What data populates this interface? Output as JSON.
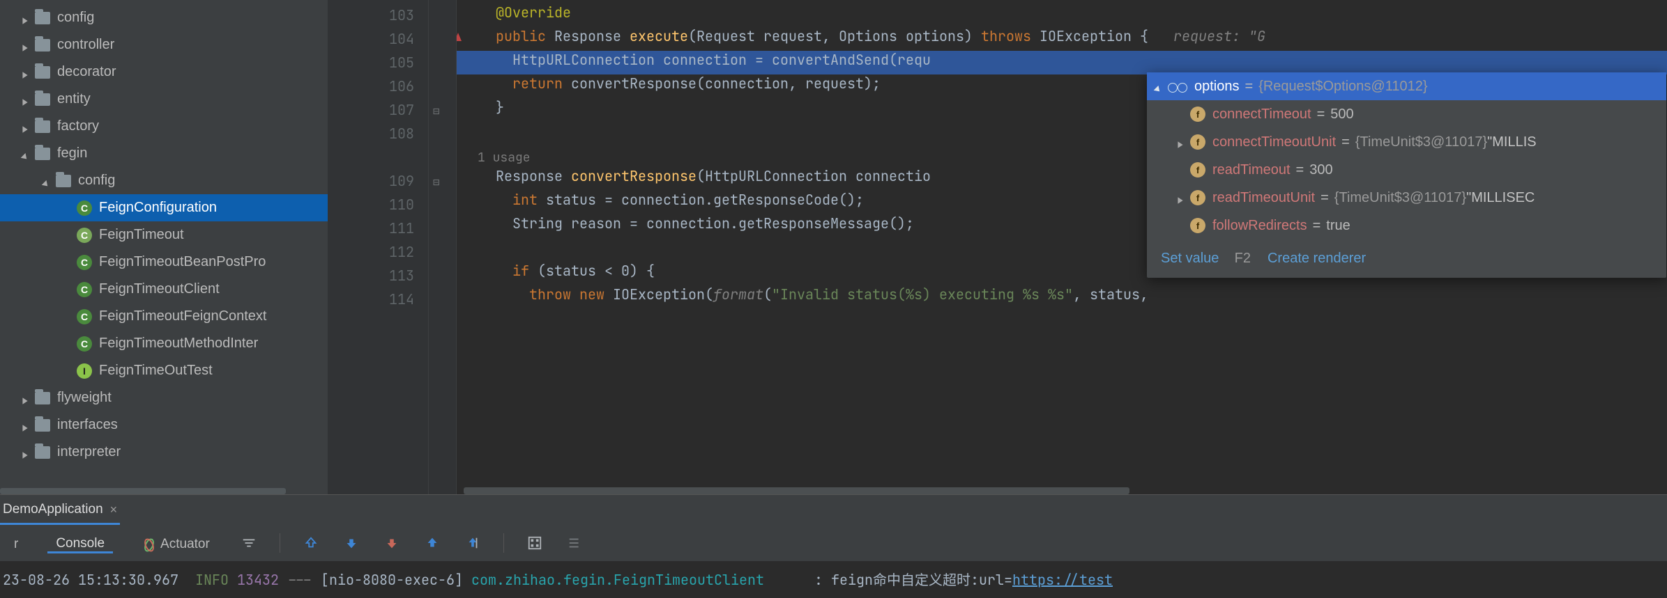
{
  "project_tree": {
    "items": [
      {
        "indent": 30,
        "arrow": "closed",
        "icon": "folder",
        "label": "config",
        "selected": false
      },
      {
        "indent": 30,
        "arrow": "closed",
        "icon": "folder",
        "label": "controller",
        "selected": false
      },
      {
        "indent": 30,
        "arrow": "closed",
        "icon": "folder",
        "label": "decorator",
        "selected": false
      },
      {
        "indent": 30,
        "arrow": "closed",
        "icon": "folder",
        "label": "entity",
        "selected": false
      },
      {
        "indent": 30,
        "arrow": "closed",
        "icon": "folder",
        "label": "factory",
        "selected": false
      },
      {
        "indent": 30,
        "arrow": "open",
        "icon": "folder",
        "label": "fegin",
        "selected": false
      },
      {
        "indent": 60,
        "arrow": "open",
        "icon": "folder",
        "label": "config",
        "selected": false
      },
      {
        "indent": 90,
        "arrow": "none",
        "icon": "class",
        "label": "FeignConfiguration",
        "selected": true
      },
      {
        "indent": 90,
        "arrow": "none",
        "icon": "class",
        "label": "FeignTimeout",
        "selected": false,
        "iconBg": "#7aa85a"
      },
      {
        "indent": 90,
        "arrow": "none",
        "icon": "class",
        "label": "FeignTimeoutBeanPostPro",
        "selected": false
      },
      {
        "indent": 90,
        "arrow": "none",
        "icon": "class",
        "label": "FeignTimeoutClient",
        "selected": false
      },
      {
        "indent": 90,
        "arrow": "none",
        "icon": "class",
        "label": "FeignTimeoutFeignContext",
        "selected": false
      },
      {
        "indent": 90,
        "arrow": "none",
        "icon": "class",
        "label": "FeignTimeoutMethodInter",
        "selected": false
      },
      {
        "indent": 90,
        "arrow": "none",
        "icon": "test",
        "label": "FeignTimeOutTest",
        "selected": false
      },
      {
        "indent": 30,
        "arrow": "closed",
        "icon": "folder",
        "label": "flyweight",
        "selected": false
      },
      {
        "indent": 30,
        "arrow": "closed",
        "icon": "folder",
        "label": "interfaces",
        "selected": false
      },
      {
        "indent": 30,
        "arrow": "closed",
        "icon": "folder",
        "label": "interpreter",
        "selected": false
      }
    ]
  },
  "editor": {
    "usage_hint": "1 usage",
    "lines": [
      {
        "n": 103,
        "segments": [
          {
            "indent": 2
          },
          {
            "t": "@Override",
            "c": "annot"
          }
        ]
      },
      {
        "n": 104,
        "marker": true,
        "segments": [
          {
            "indent": 2
          },
          {
            "t": "public ",
            "c": "kw"
          },
          {
            "t": "Response ",
            "c": "type"
          },
          {
            "t": "execute",
            "c": "method"
          },
          {
            "t": "(",
            "c": "paren"
          },
          {
            "t": "Request ",
            "c": "type"
          },
          {
            "t": "request",
            "c": "ident"
          },
          {
            "t": ", ",
            "c": "paren"
          },
          {
            "t": "Options ",
            "c": "type"
          },
          {
            "t": "options",
            "c": "ident"
          },
          {
            "t": ") ",
            "c": "paren"
          },
          {
            "t": "throws ",
            "c": "kw"
          },
          {
            "t": "IOException ",
            "c": "type"
          },
          {
            "t": "{   ",
            "c": "paren"
          },
          {
            "t": "request: \"G",
            "c": "hint"
          }
        ]
      },
      {
        "n": 105,
        "hl": true,
        "segments": [
          {
            "indent": 3
          },
          {
            "t": "HttpURLConnection ",
            "c": "type"
          },
          {
            "t": "connection ",
            "c": "ident"
          },
          {
            "t": "= ",
            "c": "paren"
          },
          {
            "t": "convertAndSend",
            "c": "ident"
          },
          {
            "t": "(",
            "c": "paren"
          },
          {
            "t": "requ",
            "c": "ident"
          }
        ]
      },
      {
        "n": 106,
        "segments": [
          {
            "indent": 3
          },
          {
            "t": "return ",
            "c": "kw"
          },
          {
            "t": "convertResponse",
            "c": "ident"
          },
          {
            "t": "(",
            "c": "paren"
          },
          {
            "t": "connection",
            "c": "ident"
          },
          {
            "t": ", ",
            "c": "paren"
          },
          {
            "t": "request",
            "c": "ident"
          },
          {
            "t": ");",
            "c": "paren"
          }
        ]
      },
      {
        "n": 107,
        "fold": "close",
        "segments": [
          {
            "indent": 2
          },
          {
            "t": "}",
            "c": "paren"
          }
        ]
      },
      {
        "n": 108,
        "segments": []
      },
      {
        "usage": true
      },
      {
        "n": 109,
        "fold": "open",
        "segments": [
          {
            "indent": 2
          },
          {
            "t": "Response ",
            "c": "type"
          },
          {
            "t": "convertResponse",
            "c": "method"
          },
          {
            "t": "(",
            "c": "paren"
          },
          {
            "t": "HttpURLConnection ",
            "c": "type"
          },
          {
            "t": "connectio",
            "c": "ident"
          }
        ]
      },
      {
        "n": 110,
        "segments": [
          {
            "indent": 3
          },
          {
            "t": "int ",
            "c": "kw"
          },
          {
            "t": "status ",
            "c": "ident"
          },
          {
            "t": "= ",
            "c": "paren"
          },
          {
            "t": "connection",
            "c": "ident"
          },
          {
            "t": ".",
            "c": "paren"
          },
          {
            "t": "getResponseCode",
            "c": "ident"
          },
          {
            "t": "();",
            "c": "paren"
          }
        ]
      },
      {
        "n": 111,
        "segments": [
          {
            "indent": 3
          },
          {
            "t": "String ",
            "c": "type"
          },
          {
            "t": "reason ",
            "c": "ident"
          },
          {
            "t": "= ",
            "c": "paren"
          },
          {
            "t": "connection",
            "c": "ident"
          },
          {
            "t": ".",
            "c": "paren"
          },
          {
            "t": "getResponseMessage",
            "c": "ident"
          },
          {
            "t": "();",
            "c": "paren"
          }
        ]
      },
      {
        "n": 112,
        "segments": []
      },
      {
        "n": 113,
        "segments": [
          {
            "indent": 3
          },
          {
            "t": "if ",
            "c": "kw"
          },
          {
            "t": "(",
            "c": "paren"
          },
          {
            "t": "status ",
            "c": "ident"
          },
          {
            "t": "< ",
            "c": "paren"
          },
          {
            "t": "0",
            "c": "ident"
          },
          {
            "t": ") {",
            "c": "paren"
          }
        ]
      },
      {
        "n": 114,
        "segments": [
          {
            "indent": 4
          },
          {
            "t": "throw new ",
            "c": "kw"
          },
          {
            "t": "IOException",
            "c": "type"
          },
          {
            "t": "(",
            "c": "paren"
          },
          {
            "t": "format",
            "c": "italic"
          },
          {
            "t": "(",
            "c": "paren"
          },
          {
            "t": "\"Invalid status(%s) executing %s %s\"",
            "c": "str"
          },
          {
            "t": ", ",
            "c": "paren"
          },
          {
            "t": "status",
            "c": "ident"
          },
          {
            "t": ",",
            "c": "paren"
          }
        ]
      }
    ]
  },
  "debug_popup": {
    "header": {
      "name": "options",
      "obj": "{Request$Options@11012}"
    },
    "fields": [
      {
        "name": "connectTimeout",
        "val": "500",
        "expandable": false
      },
      {
        "name": "connectTimeoutUnit",
        "obj": "{TimeUnit$3@11017}",
        "str": "\"MILLIS",
        "expandable": true
      },
      {
        "name": "readTimeout",
        "val": "300",
        "expandable": false
      },
      {
        "name": "readTimeoutUnit",
        "obj": "{TimeUnit$3@11017}",
        "str": "\"MILLISEC",
        "expandable": true
      },
      {
        "name": "followRedirects",
        "val": "true",
        "expandable": false
      }
    ],
    "footer": {
      "set_value": "Set value",
      "shortcut": "F2",
      "create_renderer": "Create renderer"
    }
  },
  "run_tabs": {
    "active": "DemoApplication"
  },
  "tool_toolbar": {
    "debugger_tab": "r",
    "console_tab": "Console",
    "actuator_tab": "Actuator"
  },
  "console": {
    "timestamp": "23-08-26 15:13:30.967  ",
    "level": "INFO ",
    "pid": "13432 ",
    "sep": "--- ",
    "thread": "[nio-8080-exec-6] ",
    "logger": "com.zhihao.fegin.FeignTimeoutClient     ",
    "colon": " : ",
    "msg": "feign命中自定义超时:url=",
    "url": "https://test"
  }
}
